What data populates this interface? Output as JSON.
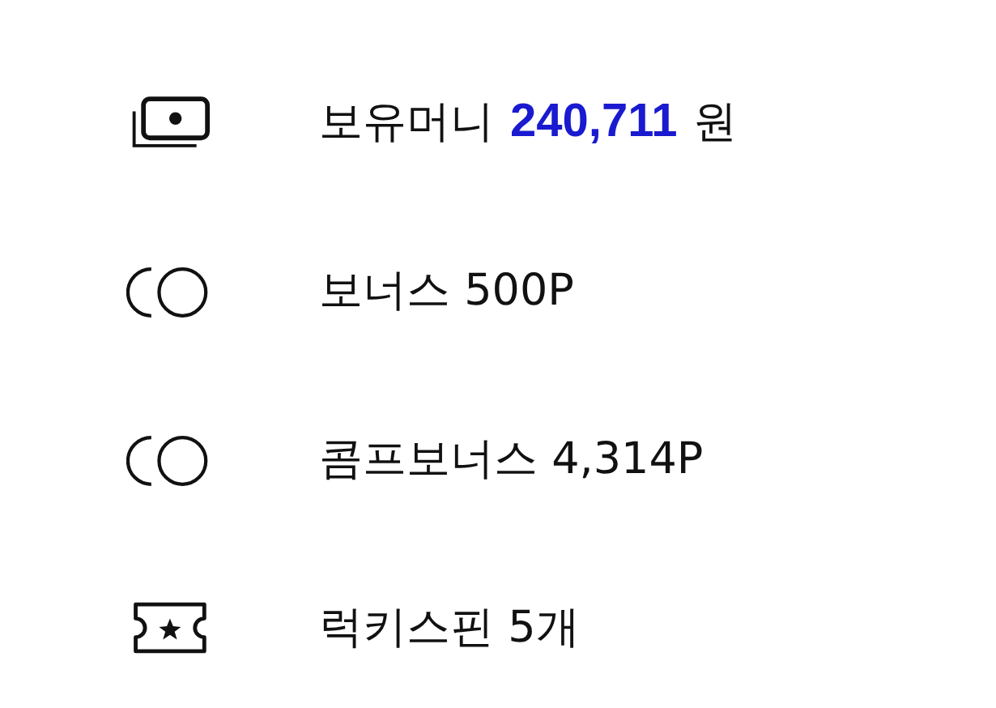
{
  "items": [
    {
      "kind": "money",
      "label": "보유머니",
      "amount": "240,711",
      "unit": "원"
    },
    {
      "kind": "coins",
      "label": "보너스 500P"
    },
    {
      "kind": "coins",
      "label": "콤프보너스 4,314P"
    },
    {
      "kind": "ticket",
      "label": "럭키스핀 5개"
    }
  ]
}
